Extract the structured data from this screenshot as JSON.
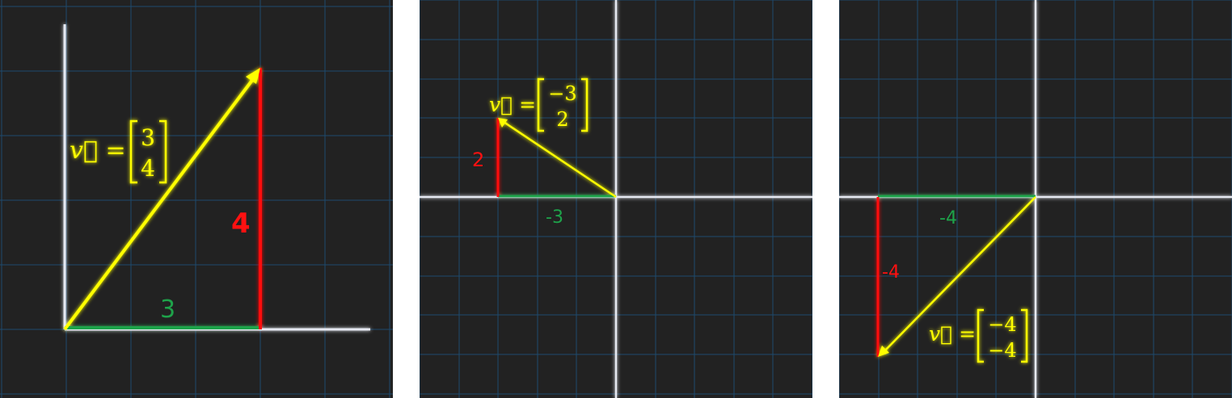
{
  "colors": {
    "background": "#222222",
    "grid": "#1d4a6e",
    "axis": "#e6e9f2",
    "vector": "#ffff00",
    "x_component": "#1ea34a",
    "y_component": "#ff1111"
  },
  "panels": [
    {
      "vector": [
        3,
        4
      ],
      "vector_label": "v⃗ =",
      "matrix_top": "3",
      "matrix_bottom": "4",
      "x_label": "3",
      "y_label": "4"
    },
    {
      "vector": [
        -3,
        2
      ],
      "vector_label": "v⃗ =",
      "matrix_top": "−3",
      "matrix_bottom": "2",
      "x_label": "-3",
      "y_label": "2"
    },
    {
      "vector": [
        -4,
        -4
      ],
      "vector_label": "v⃗ =",
      "matrix_top": "−4",
      "matrix_bottom": "−4",
      "x_label": "-4",
      "y_label": "-4"
    }
  ]
}
